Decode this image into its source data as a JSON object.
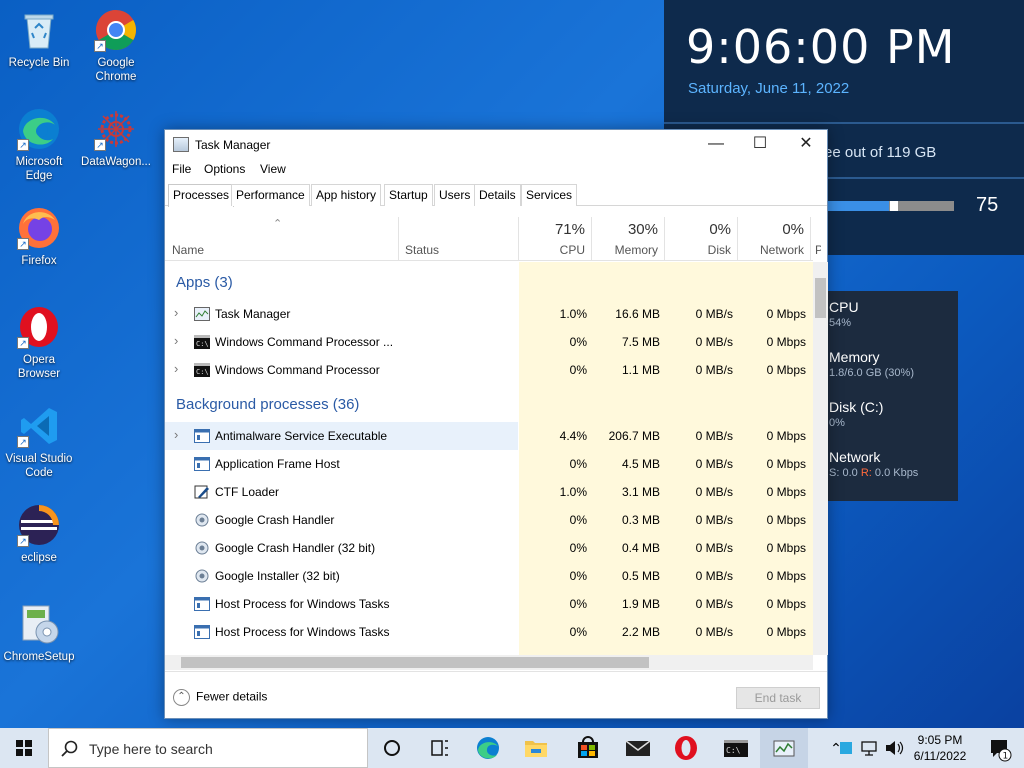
{
  "desktop_icons": [
    {
      "label": "Recycle Bin",
      "icon": "recycle-bin-icon"
    },
    {
      "label": "Google Chrome",
      "icon": "chrome-icon"
    },
    {
      "label": "Microsoft Edge",
      "icon": "edge-icon"
    },
    {
      "label": "DataWagon...",
      "icon": "datawagon-icon"
    },
    {
      "label": "Firefox",
      "icon": "firefox-icon"
    },
    {
      "label": "Opera Browser",
      "icon": "opera-icon"
    },
    {
      "label": "Visual Studio Code",
      "icon": "vscode-icon"
    },
    {
      "label": "eclipse",
      "icon": "eclipse-icon"
    },
    {
      "label": "ChromeSetup",
      "icon": "chrome-setup-icon"
    }
  ],
  "widget": {
    "clock": "9:06:00 PM",
    "date": "Saturday, June 11, 2022",
    "disk_free": "ee out of 119 GB",
    "bar_value": "75",
    "bar_fraction": 0.5
  },
  "sys_panel": {
    "cpu": {
      "title": "CPU",
      "sub": "54%"
    },
    "memory": {
      "title": "Memory",
      "sub": "1.8/6.0 GB (30%)"
    },
    "disk": {
      "title": "Disk (C:)",
      "sub": "0%"
    },
    "network": {
      "title": "Network",
      "sub_s_label": "S:",
      "sub_s_value": "0.0",
      "sub_r_label": "R:",
      "sub_r_value": "0.0 Kbps"
    }
  },
  "task_manager": {
    "title": "Task Manager",
    "menu": [
      "File",
      "Options",
      "View"
    ],
    "tabs": [
      "Processes",
      "Performance",
      "App history",
      "Startup",
      "Users",
      "Details",
      "Services"
    ],
    "active_tab": "Processes",
    "headers": {
      "name": "Name",
      "status": "Status",
      "cpu": {
        "pct": "71%",
        "label": "CPU"
      },
      "memory": {
        "pct": "30%",
        "label": "Memory"
      },
      "disk": {
        "pct": "0%",
        "label": "Disk"
      },
      "network": {
        "pct": "0%",
        "label": "Network"
      },
      "power_partial": "P"
    },
    "groups": {
      "apps": "Apps (3)",
      "background": "Background processes (36)"
    },
    "apps": [
      {
        "name": "Task Manager",
        "cpu": "1.0%",
        "memory": "16.6 MB",
        "disk": "0 MB/s",
        "network": "0 Mbps"
      },
      {
        "name": "Windows Command Processor ...",
        "cpu": "0%",
        "memory": "7.5 MB",
        "disk": "0 MB/s",
        "network": "0 Mbps"
      },
      {
        "name": "Windows Command Processor",
        "cpu": "0%",
        "memory": "1.1 MB",
        "disk": "0 MB/s",
        "network": "0 Mbps"
      }
    ],
    "background": [
      {
        "name": "Antimalware Service Executable",
        "cpu": "4.4%",
        "memory": "206.7 MB",
        "disk": "0 MB/s",
        "network": "0 Mbps",
        "expandable": true
      },
      {
        "name": "Application Frame Host",
        "cpu": "0%",
        "memory": "4.5 MB",
        "disk": "0 MB/s",
        "network": "0 Mbps"
      },
      {
        "name": "CTF Loader",
        "cpu": "1.0%",
        "memory": "3.1 MB",
        "disk": "0 MB/s",
        "network": "0 Mbps"
      },
      {
        "name": "Google Crash Handler",
        "cpu": "0%",
        "memory": "0.3 MB",
        "disk": "0 MB/s",
        "network": "0 Mbps"
      },
      {
        "name": "Google Crash Handler (32 bit)",
        "cpu": "0%",
        "memory": "0.4 MB",
        "disk": "0 MB/s",
        "network": "0 Mbps"
      },
      {
        "name": "Google Installer (32 bit)",
        "cpu": "0%",
        "memory": "0.5 MB",
        "disk": "0 MB/s",
        "network": "0 Mbps"
      },
      {
        "name": "Host Process for Windows Tasks",
        "cpu": "0%",
        "memory": "1.9 MB",
        "disk": "0 MB/s",
        "network": "0 Mbps"
      },
      {
        "name": "Host Process for Windows Tasks",
        "cpu": "0%",
        "memory": "2.2 MB",
        "disk": "0 MB/s",
        "network": "0 Mbps"
      }
    ],
    "fewer_details": "Fewer details",
    "end_task": "End task"
  },
  "taskbar": {
    "search_placeholder": "Type here to search",
    "time": "9:05 PM",
    "date": "6/11/2022",
    "notification_count": "1"
  }
}
